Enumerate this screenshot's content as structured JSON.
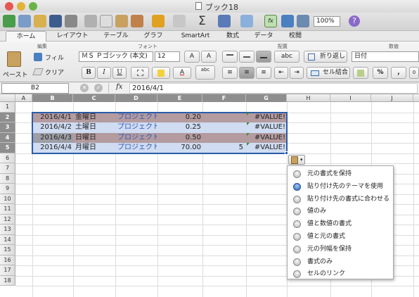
{
  "window": {
    "title": "ブック18"
  },
  "toolbar": {
    "zoom": "100%"
  },
  "tabs": [
    "ホーム",
    "レイアウト",
    "テーブル",
    "グラフ",
    "SmartArt",
    "数式",
    "データ",
    "校閲"
  ],
  "groups": {
    "edit": "編集",
    "font": "フォント",
    "align": "配置",
    "number": "数値"
  },
  "ribbon": {
    "fill": "フィル",
    "clear": "クリア",
    "paste": "ペースト",
    "font_name": "ＭＳ Ｐゴシック (本文)",
    "font_size": "12",
    "bold": "B",
    "italic": "I",
    "underline": "U",
    "grow": "A",
    "shrink": "A",
    "font_color": "A",
    "wrap": "折り返し",
    "merge": "セル結合",
    "abc": "abc",
    "number_format": "日付",
    "percent": "%",
    "comma": ",",
    "decimal": "0"
  },
  "formula_bar": {
    "cell_ref": "B2",
    "fx": "fx",
    "value": "2016/4/1"
  },
  "columns": [
    "A",
    "B",
    "C",
    "D",
    "E",
    "F",
    "G",
    "H",
    "I",
    "J"
  ],
  "rows": [
    "1",
    "2",
    "3",
    "4",
    "5",
    "6",
    "7",
    "8",
    "9",
    "10",
    "11",
    "12",
    "13",
    "14",
    "15",
    "16",
    "17",
    "18"
  ],
  "cells": [
    [
      "2016/4/1",
      "金曜日",
      "プロジェクト 1",
      "0.20",
      "",
      "#VALUE!"
    ],
    [
      "2016/4/2",
      "土曜日",
      "プロジェクト 1",
      "0.25",
      "",
      "#VALUE!"
    ],
    [
      "2016/4/3",
      "日曜日",
      "プロジェクト 2",
      "0.50",
      "",
      "#VALUE!"
    ],
    [
      "2016/4/4",
      "月曜日",
      "プロジェクト 2",
      "70.00",
      "5",
      "#VALUE!"
    ]
  ],
  "paste_menu": [
    "元の書式を保持",
    "貼り付け先のテーマを使用",
    "貼り付け先の書式に合わせる",
    "値のみ",
    "値と数値の書式",
    "値と元の書式",
    "元の列幅を保持",
    "書式のみ",
    "セルのリンク"
  ],
  "paste_selected": 1,
  "colors": {
    "band_dark": "#b49b9f",
    "band_light": "#cfdcf2",
    "select_border": "#2a5caa",
    "project_text": "#2f57b6"
  }
}
